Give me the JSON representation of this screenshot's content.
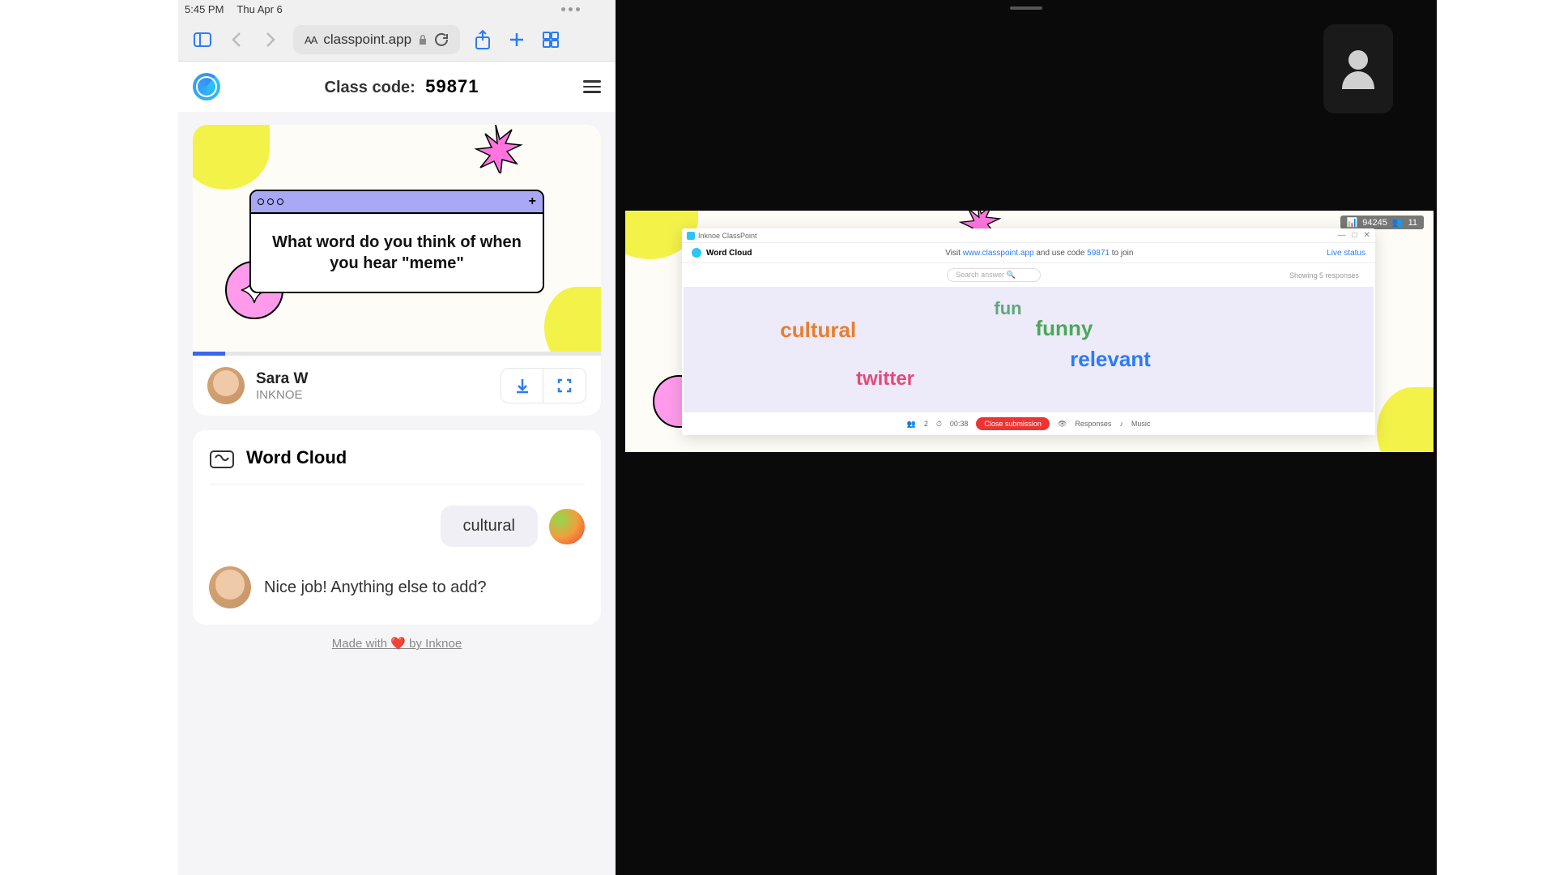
{
  "status": {
    "time": "5:45 PM",
    "date": "Thu Apr 6"
  },
  "url": "classpoint.app",
  "header": {
    "class_code_label": "Class code:",
    "class_code_value": "59871"
  },
  "slide": {
    "prompt_line1": "What word do you think of when",
    "prompt_line2": "you hear \"meme\""
  },
  "presenter": {
    "name": "Sara W",
    "org": "INKNOE"
  },
  "activity": {
    "title": "Word Cloud"
  },
  "response": {
    "word": "cultural"
  },
  "teacher_msg": "Nice job! Anything else to add?",
  "footer": "Made with ❤️ by Inknoe",
  "projector": {
    "badge_code": "94245",
    "badge_count": "11",
    "window_title": "Inknoe ClassPoint",
    "activity_label": "Word Cloud",
    "instruction_pre": "Visit ",
    "instruction_url": "www.classpoint.app",
    "instruction_mid": " and use code ",
    "instruction_code": "59871",
    "instruction_post": " to join",
    "live_status": "Live status",
    "search_placeholder": "Search answer",
    "responses_text": "Showing 5 responses",
    "words": {
      "fun": "fun",
      "cultural": "cultural",
      "funny": "funny",
      "relevant": "relevant",
      "twitter": "twitter"
    },
    "footer_count": "2",
    "footer_time": "00:38",
    "close_label": "Close submission",
    "responses_label": "Responses",
    "music_label": "Music"
  }
}
